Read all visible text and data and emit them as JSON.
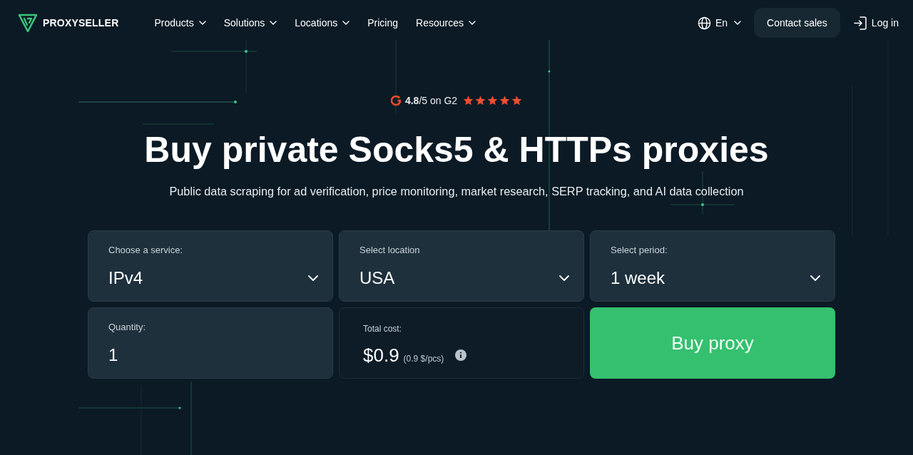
{
  "header": {
    "logo": "PROXYSELLER",
    "nav": [
      {
        "label": "Products",
        "dropdown": true
      },
      {
        "label": "Solutions",
        "dropdown": true
      },
      {
        "label": "Locations",
        "dropdown": true
      },
      {
        "label": "Pricing",
        "dropdown": false
      },
      {
        "label": "Resources",
        "dropdown": true
      }
    ],
    "language": "En",
    "contact_button": "Contact sales",
    "login": "Log in"
  },
  "rating": {
    "text": "**4.8**/5 on G2",
    "stars": 5
  },
  "hero": {
    "title": "Buy private Socks5 & HTTPs proxies",
    "subtitle": "Public data scraping for ad verification, price monitoring, market research, SERP tracking, and AI data collection"
  },
  "order_form": {
    "fields": [
      {
        "kind": "select",
        "label": "Choose a service:",
        "value": "IPv4"
      },
      {
        "kind": "select",
        "label": "Select location",
        "value": "USA"
      },
      {
        "kind": "select",
        "label": "Select period:",
        "value": "1 week"
      },
      {
        "kind": "number",
        "label": "Quantity:",
        "value": "1"
      }
    ],
    "total": {
      "label": "Total cost:",
      "amount": "$0.9",
      "unit_price": "(0.9 $/pcs)"
    },
    "buy_button": "Buy proxy"
  }
}
